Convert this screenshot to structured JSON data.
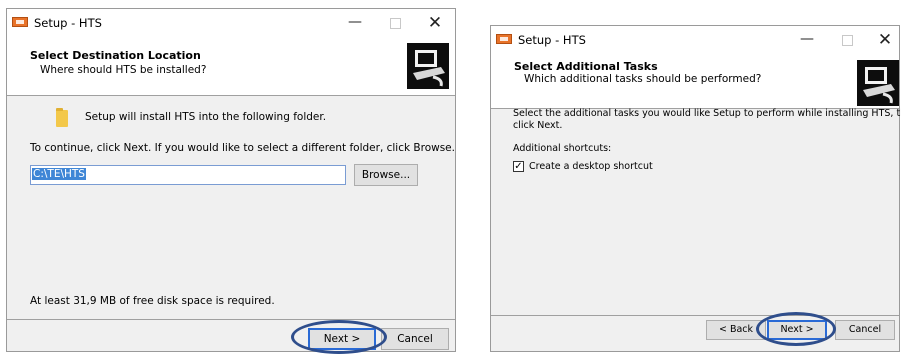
{
  "left_window": {
    "title": "Setup - HTS",
    "header_title": "Select Destination Location",
    "header_subtitle": "Where should HTS be installed?",
    "install_message": "Setup will install HTS into the following folder.",
    "instruction": "To continue, click Next. If you would like to select a different folder, click Browse.",
    "path_value": "C:\\TE\\HTS",
    "browse_label": "Browse...",
    "disk_space": "At least 31,9 MB of free disk space is required.",
    "next_label": "Next >",
    "cancel_label": "Cancel"
  },
  "right_window": {
    "title": "Setup - HTS",
    "header_title": "Select Additional Tasks",
    "header_subtitle": "Which additional tasks should be performed?",
    "instruction_line1": "Select the additional tasks you would like Setup to perform while installing HTS, then",
    "instruction_line2": "click Next.",
    "shortcuts_label": "Additional shortcuts:",
    "desktop_shortcut_label": "Create a desktop shortcut",
    "desktop_shortcut_checked": true,
    "back_label": "< Back",
    "next_label": "Next >",
    "cancel_label": "Cancel"
  },
  "icons": {
    "app": "installer-icon",
    "minimize": "minimize-icon",
    "maximize": "maximize-icon",
    "close": "close-icon",
    "logo": "computer-setup-logo",
    "folder": "folder-icon",
    "checkmark": "checkmark-icon"
  },
  "colors": {
    "highlight": "#2f4e8c",
    "selection": "#3f86d6",
    "default_button_border": "#2a6ad5"
  }
}
